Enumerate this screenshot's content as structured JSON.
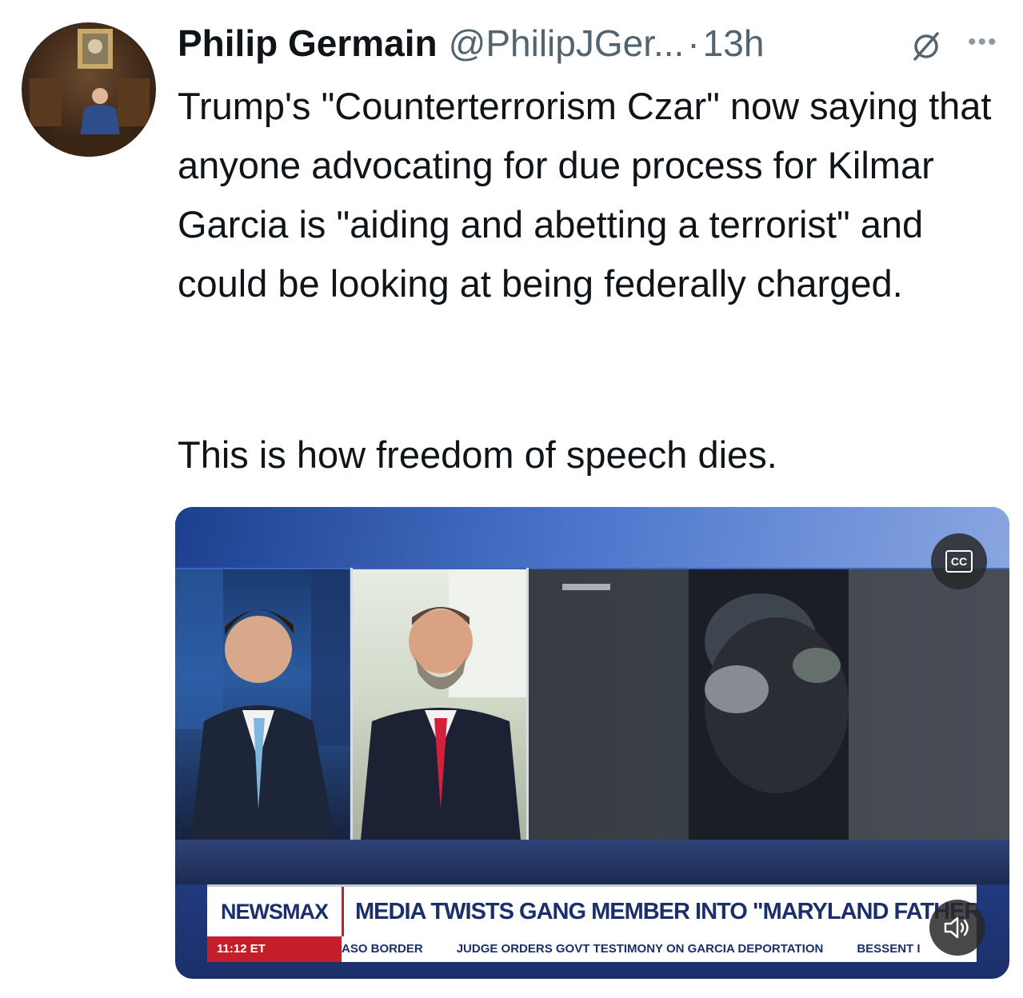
{
  "author": {
    "display_name": "Philip Germain",
    "handle": "@PhilipJGer...",
    "separator": "·",
    "time": "13h"
  },
  "icons": {
    "avatar": "profile-photo",
    "grok": "grok-icon",
    "more": "more-icon",
    "captions": "cc-icon",
    "volume": "volume-icon"
  },
  "tweet": {
    "text": "Trump's \"Counterterrorism Czar\" now saying that anyone advocating for due process for Kilmar Garcia is \"aiding and abetting a terrorist\" and could be looking at being federally charged.",
    "text2": "This is how freedom of speech dies."
  },
  "media": {
    "cc_label": "CC",
    "network": "NEWSMAX",
    "headline": "MEDIA TWISTS GANG MEMBER INTO \"MARYLAND FATHER\"",
    "timestamp": "11:12 ET",
    "ticker": [
      "ASO BORDER",
      "JUDGE ORDERS GOVT TESTIMONY ON GARCIA DEPORTATION",
      "BESSENT I"
    ]
  },
  "colors": {
    "text": "#0f1419",
    "secondary": "#536471",
    "newsmax_blue": "#1a2f6b",
    "newsmax_red": "#c41e2a"
  }
}
